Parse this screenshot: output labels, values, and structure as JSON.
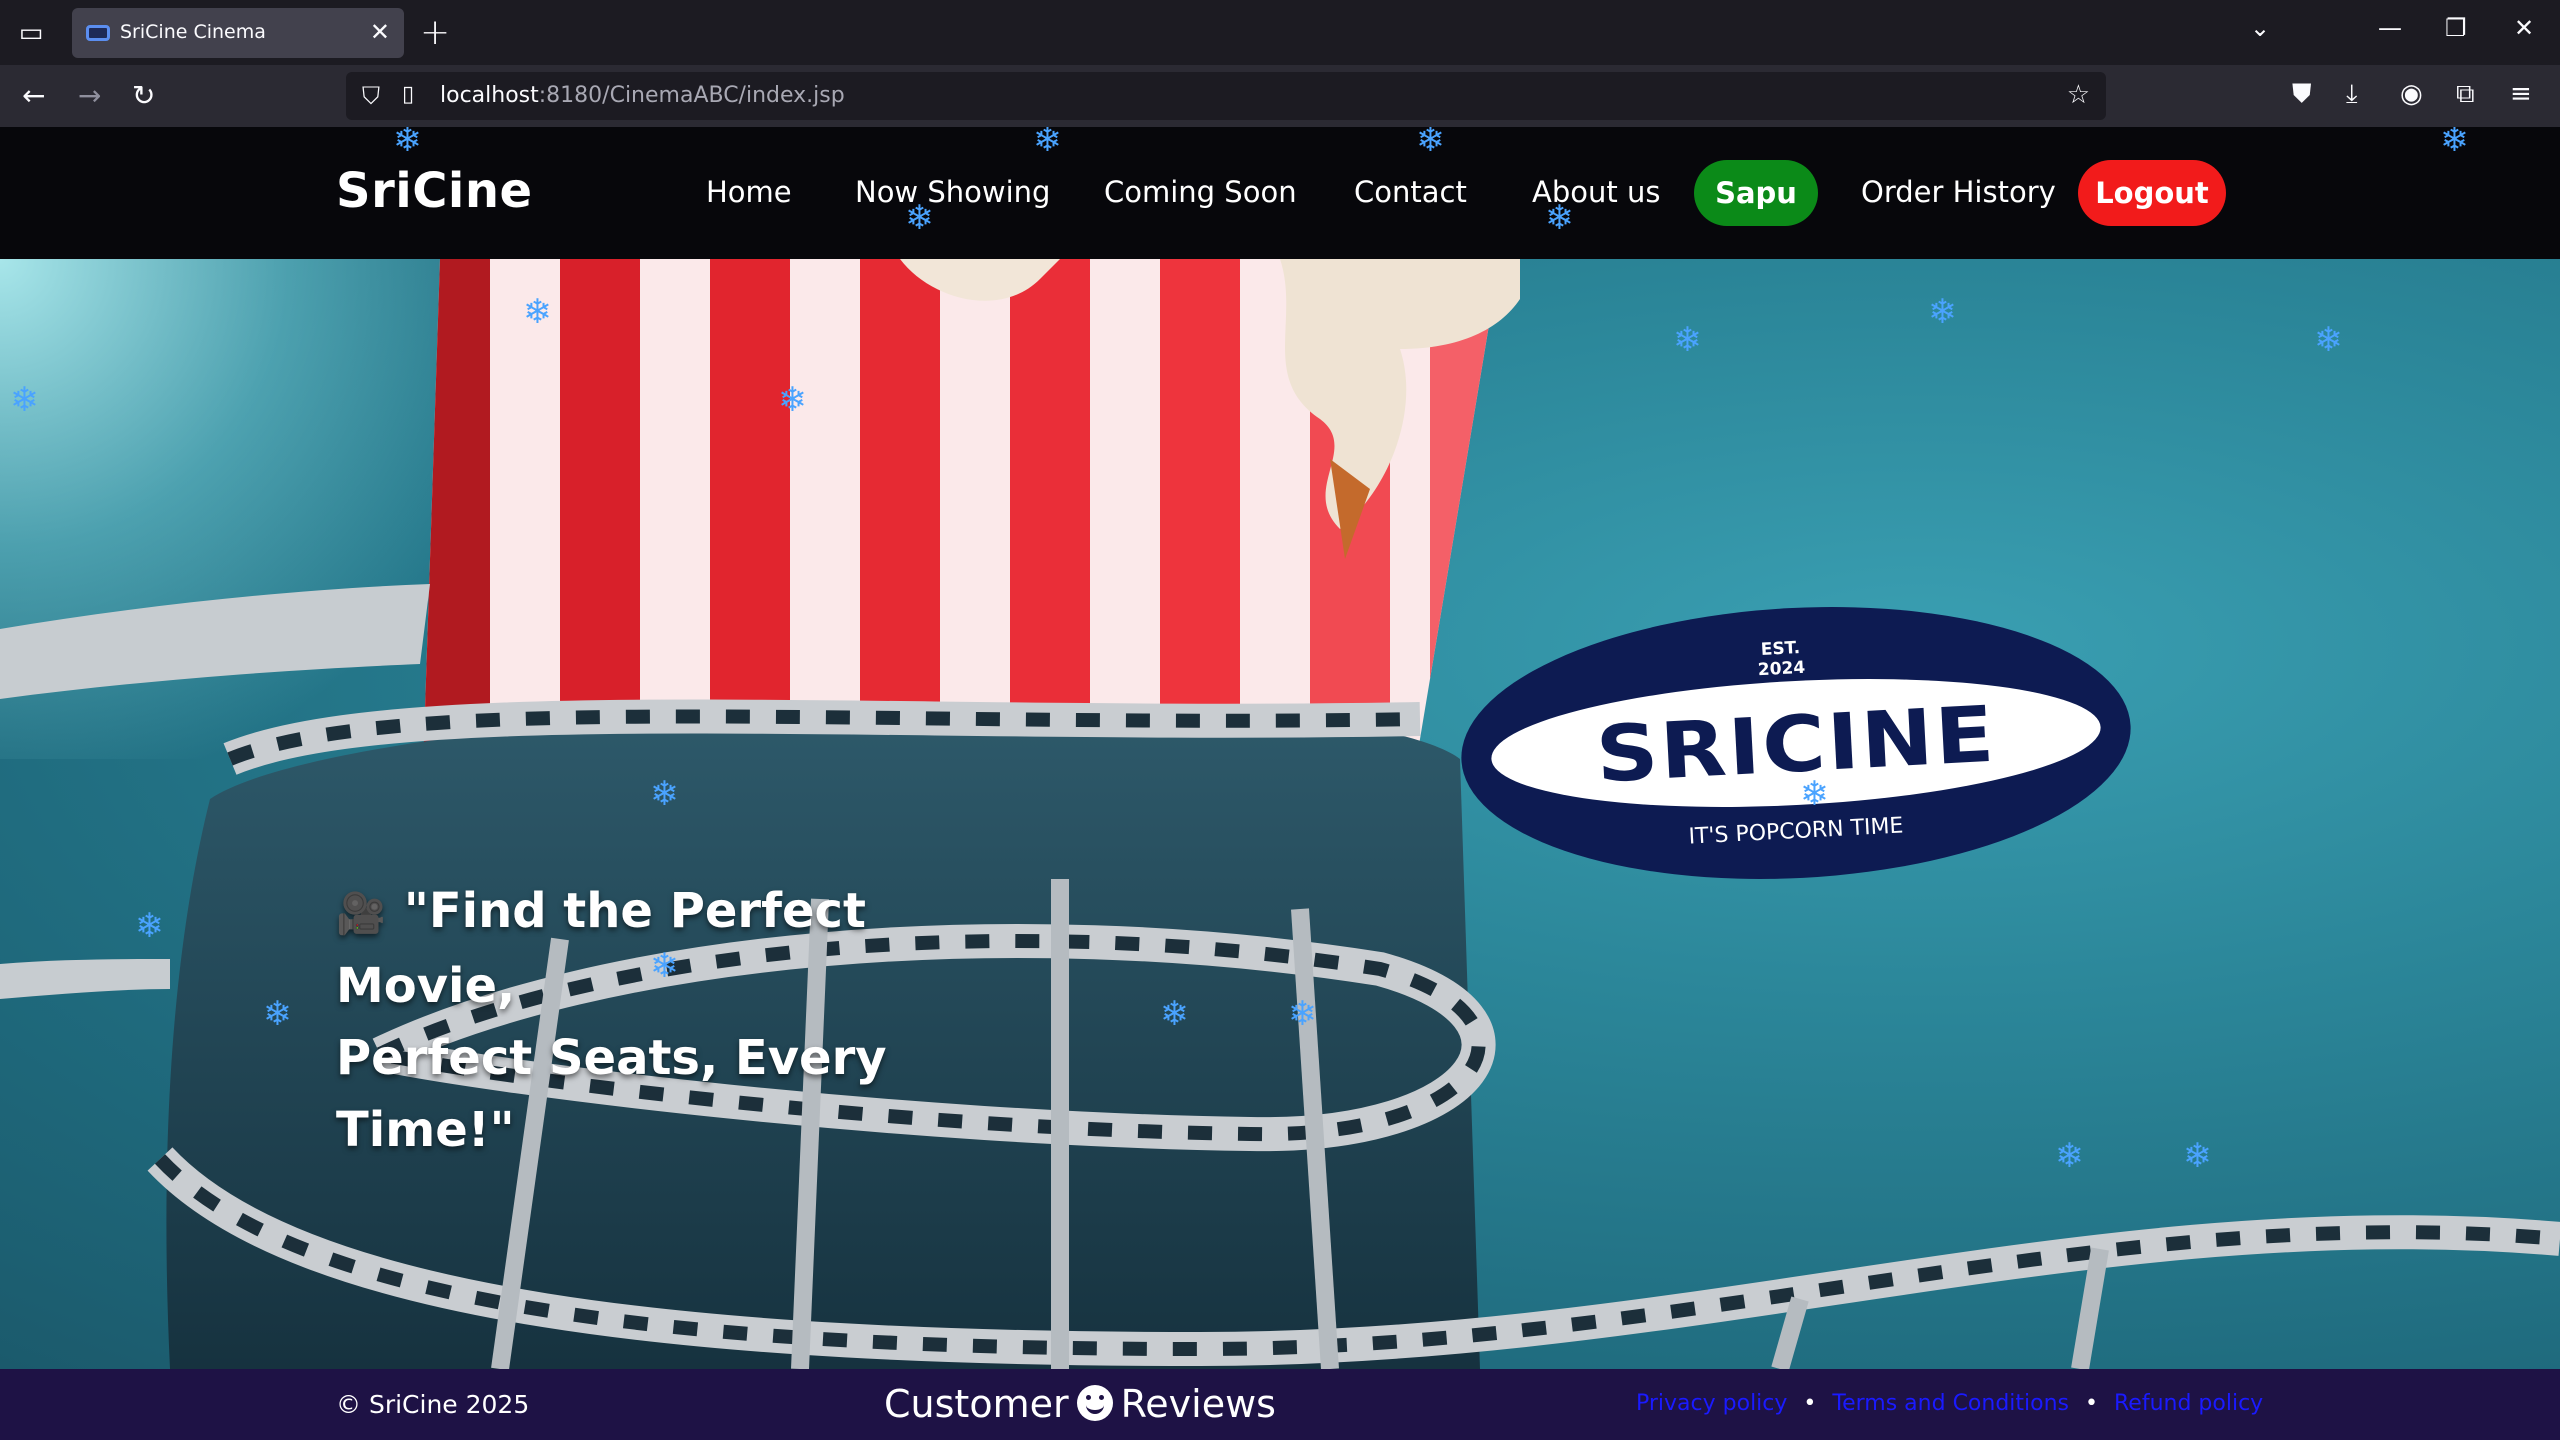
{
  "browser": {
    "tab_title": "SriCine Cinema",
    "url_host": "localhost",
    "url_rest": ":8180/CinemaABC/index.jsp"
  },
  "site": {
    "brand": "SriCine",
    "nav": {
      "home": "Home",
      "now_showing": "Now Showing",
      "coming_soon": "Coming Soon",
      "contact": "Contact",
      "about": "About us",
      "user": "Sapu",
      "order_history": "Order History",
      "logout": "Logout"
    },
    "hero": {
      "quote_line1": "\"Find the Perfect Movie,",
      "quote_line2": "Perfect Seats, Every Time!\"",
      "logo_est": "EST. 2024",
      "logo_name": "SRICINE",
      "logo_tagline": "IT'S POPCORN TIME"
    },
    "footer": {
      "copyright": "© SriCine 2025",
      "reviews_left": "Customer",
      "reviews_right": "Reviews",
      "privacy": "Privacy policy",
      "terms": "Terms and Conditions",
      "refund": "Refund policy"
    }
  },
  "colors": {
    "header_bg": "#07070b",
    "user_pill": "#0b8a18",
    "logout_pill": "#f21b1b",
    "footer_bg": "#1e1245",
    "link_color": "#1a1aff",
    "snowflake": "#4aa3ff"
  },
  "icons": {
    "snowflake": "snowflake-icon",
    "camera": "movie-camera-icon"
  }
}
